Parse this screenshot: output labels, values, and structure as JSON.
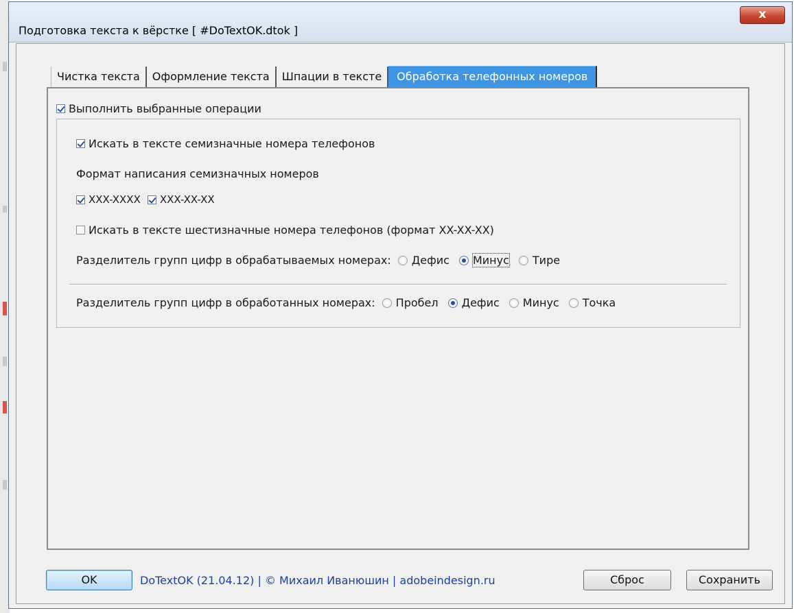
{
  "window": {
    "title": "Подготовка текста к вёрстке  [ #DoTextOK.dtok ]",
    "close_label": "x"
  },
  "tabs": [
    {
      "label": "Чистка текста",
      "active": false
    },
    {
      "label": "Оформление текста",
      "active": false
    },
    {
      "label": "Шпации в тексте",
      "active": false
    },
    {
      "label": "Обработка телефонных номеров",
      "active": true
    }
  ],
  "panel": {
    "execute": {
      "label": "Выполнить выбранные операции",
      "checked": true
    },
    "seven_digit": {
      "label": "Искать в тексте семизначные номера телефонов",
      "checked": true
    },
    "format_heading": "Формат написания семизначных номеров",
    "formats": [
      {
        "label": "XXX-XXXX",
        "checked": true
      },
      {
        "label": "XXX-XX-XX",
        "checked": true
      }
    ],
    "six_digit": {
      "label": "Искать в тексте шестизначные номера телефонов (формат XX-XX-XX)",
      "checked": false
    },
    "input_separator": {
      "label": "Разделитель групп цифр в обрабатываемых номерах:",
      "options": [
        "Дефис",
        "Минус",
        "Тире"
      ],
      "selected": "Минус"
    },
    "output_separator": {
      "label": "Разделитель групп цифр в обработанных номерах:",
      "options": [
        "Пробел",
        "Дефис",
        "Минус",
        "Точка"
      ],
      "selected": "Дефис"
    }
  },
  "footer": {
    "ok_label": "OK",
    "info_text": "DoTextOK (21.04.12) | © Михаил Иванюшин | adobeindesign.ru",
    "reset_label": "Сброс",
    "save_label": "Сохранить"
  }
}
